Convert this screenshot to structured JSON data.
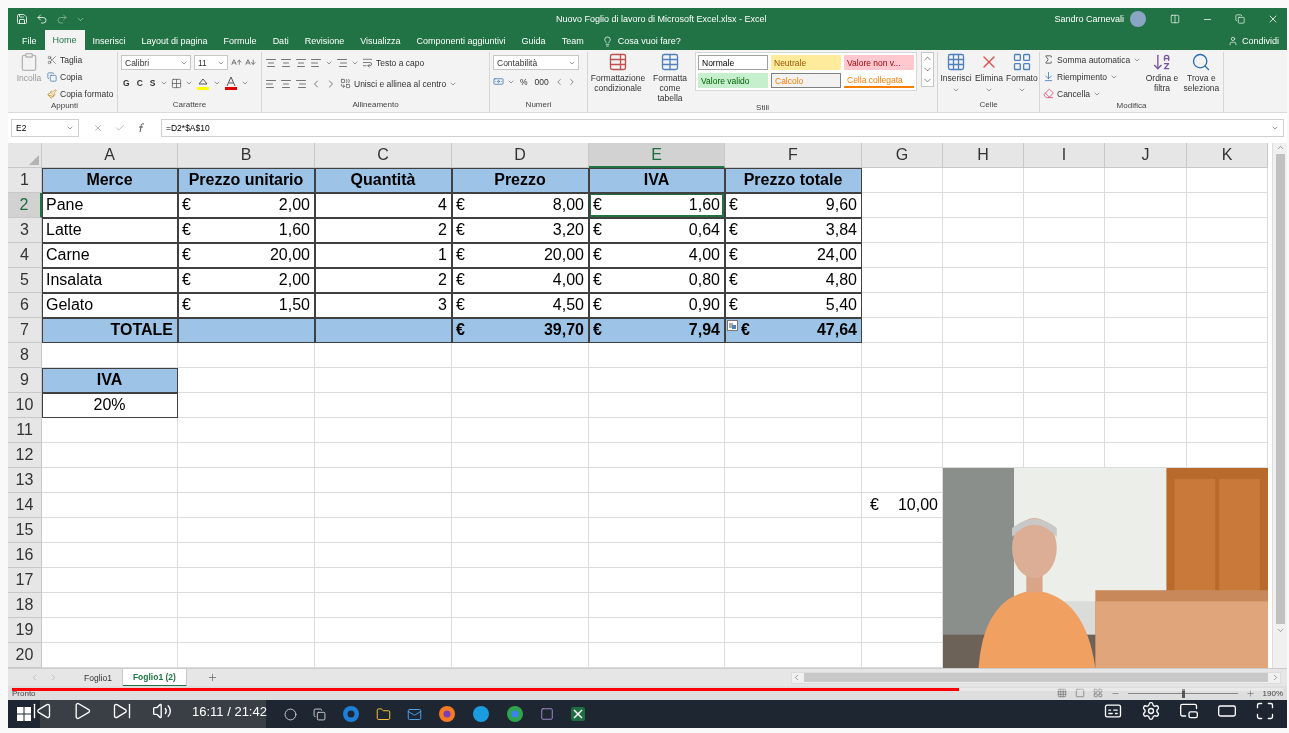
{
  "title_bar": {
    "title": "Nuovo Foglio di lavoro di Microsoft Excel.xlsx  -  Excel",
    "user": "Sandro Carnevali"
  },
  "menu_tabs": [
    {
      "label": "File",
      "selected": false
    },
    {
      "label": "Home",
      "selected": true
    },
    {
      "label": "Inserisci",
      "selected": false
    },
    {
      "label": "Layout di pagina",
      "selected": false
    },
    {
      "label": "Formule",
      "selected": false
    },
    {
      "label": "Dati",
      "selected": false
    },
    {
      "label": "Revisione",
      "selected": false
    },
    {
      "label": "Visualizza",
      "selected": false
    },
    {
      "label": "Componenti aggiuntivi",
      "selected": false
    },
    {
      "label": "Guida",
      "selected": false
    },
    {
      "label": "Team",
      "selected": false
    }
  ],
  "tell_me": {
    "placeholder": "Cosa vuoi fare?"
  },
  "share": "Condividi",
  "ribbon": [
    {
      "kind": "clipboard",
      "label": "Appunti",
      "items": [
        {
          "label": "Incolla",
          "disabled": true
        },
        {
          "label": "Taglia",
          "disabled": false
        },
        {
          "label": "Copia",
          "disabled": false
        },
        {
          "label": "Copia formato",
          "disabled": false
        }
      ]
    },
    {
      "kind": "font",
      "label": "Carattere",
      "font": "Calibri",
      "size": "11",
      "buttons": [
        "G",
        "C",
        "S"
      ]
    },
    {
      "kind": "alignment",
      "label": "Allineamento",
      "items": [
        "Testo a capo",
        "Unisci e allinea al centro"
      ]
    },
    {
      "kind": "number",
      "label": "Numeri",
      "format": "Contabilità",
      "buttons": [
        "%",
        "000"
      ]
    },
    {
      "kind": "styles",
      "label": "Stili",
      "items": [
        "Formattazione condizionale",
        "Formatta come tabella"
      ],
      "cell_styles": [
        {
          "label": "Normale",
          "kind": "normal"
        },
        {
          "label": "Neutrale",
          "kind": "neutral"
        },
        {
          "label": "Valore non v...",
          "kind": "bad"
        },
        {
          "label": "Valore valido",
          "kind": "good"
        },
        {
          "label": "Calcolo",
          "kind": "calc"
        },
        {
          "label": "Cella collegata",
          "kind": "linked"
        }
      ]
    },
    {
      "kind": "cells",
      "label": "Celle",
      "items": [
        "Inserisci",
        "Elimina",
        "Formato"
      ]
    },
    {
      "kind": "editing",
      "label": "Modifica",
      "items": [
        "Somma automatica",
        "Riempimento",
        "Cancella"
      ],
      "large_items": [
        "Ordina e filtra",
        "Trova e seleziona"
      ]
    }
  ],
  "formula_bar": {
    "name_box": "E2",
    "formula": "=D2*$A$10"
  },
  "columns": [
    {
      "label": "A",
      "selected": false
    },
    {
      "label": "B",
      "selected": false
    },
    {
      "label": "C",
      "selected": false
    },
    {
      "label": "D",
      "selected": false
    },
    {
      "label": "E",
      "selected": true
    },
    {
      "label": "F",
      "selected": false
    },
    {
      "label": "G",
      "selected": false
    },
    {
      "label": "H",
      "selected": false
    },
    {
      "label": "I",
      "selected": false
    },
    {
      "label": "J",
      "selected": false
    },
    {
      "label": "K",
      "selected": false
    }
  ],
  "rows": [
    {
      "label": "1",
      "selected": false,
      "cells": [
        {
          "kind": "header",
          "text": "Merce"
        },
        {
          "kind": "header",
          "text": "Prezzo unitario"
        },
        {
          "kind": "header",
          "text": "Quantità"
        },
        {
          "kind": "header",
          "text": "Prezzo"
        },
        {
          "kind": "header",
          "text": "IVA"
        },
        {
          "kind": "header",
          "text": "Prezzo totale"
        }
      ]
    },
    {
      "label": "2",
      "selected": true,
      "cells": [
        {
          "kind": "item",
          "text": "Pane"
        },
        {
          "kind": "price",
          "symbol": "€",
          "amount": "2,00"
        },
        {
          "kind": "quantity",
          "text": "4"
        },
        {
          "kind": "price",
          "symbol": "€",
          "amount": "8,00"
        },
        {
          "kind": "price",
          "symbol": "€",
          "amount": "1,60"
        },
        {
          "kind": "price",
          "symbol": "€",
          "amount": "9,60"
        }
      ]
    },
    {
      "label": "3",
      "selected": false,
      "cells": [
        {
          "kind": "item",
          "text": "Latte"
        },
        {
          "kind": "price",
          "symbol": "€",
          "amount": "1,60"
        },
        {
          "kind": "quantity",
          "text": "2"
        },
        {
          "kind": "price",
          "symbol": "€",
          "amount": "3,20"
        },
        {
          "kind": "price",
          "symbol": "€",
          "amount": "0,64"
        },
        {
          "kind": "price",
          "symbol": "€",
          "amount": "3,84"
        }
      ]
    },
    {
      "label": "4",
      "selected": false,
      "cells": [
        {
          "kind": "item",
          "text": "Carne"
        },
        {
          "kind": "price",
          "symbol": "€",
          "amount": "20,00"
        },
        {
          "kind": "quantity",
          "text": "1"
        },
        {
          "kind": "price",
          "symbol": "€",
          "amount": "20,00"
        },
        {
          "kind": "price",
          "symbol": "€",
          "amount": "4,00"
        },
        {
          "kind": "price",
          "symbol": "€",
          "amount": "24,00"
        }
      ]
    },
    {
      "label": "5",
      "selected": false,
      "cells": [
        {
          "kind": "item",
          "text": "Insalata"
        },
        {
          "kind": "price",
          "symbol": "€",
          "amount": "2,00"
        },
        {
          "kind": "quantity",
          "text": "2"
        },
        {
          "kind": "price",
          "symbol": "€",
          "amount": "4,00"
        },
        {
          "kind": "price",
          "symbol": "€",
          "amount": "0,80"
        },
        {
          "kind": "price",
          "symbol": "€",
          "amount": "4,80"
        }
      ]
    },
    {
      "label": "6",
      "selected": false,
      "cells": [
        {
          "kind": "item",
          "text": "Gelato"
        },
        {
          "kind": "price",
          "symbol": "€",
          "amount": "1,50"
        },
        {
          "kind": "quantity",
          "text": "3"
        },
        {
          "kind": "price",
          "symbol": "€",
          "amount": "4,50"
        },
        {
          "kind": "price",
          "symbol": "€",
          "amount": "0,90"
        },
        {
          "kind": "price",
          "symbol": "€",
          "amount": "5,40"
        }
      ]
    },
    {
      "label": "7",
      "selected": false,
      "cells": [
        {
          "kind": "total_label",
          "text": "TOTALE"
        },
        {
          "kind": "total_blank"
        },
        {
          "kind": "total_blank"
        },
        {
          "kind": "total_price",
          "symbol": "€",
          "amount": "39,70"
        },
        {
          "kind": "total_price",
          "symbol": "€",
          "amount": "7,94"
        },
        {
          "kind": "total_price",
          "symbol": "€",
          "amount": "47,64",
          "paste_options": true
        }
      ]
    },
    {
      "label": "8",
      "selected": false,
      "cells": []
    },
    {
      "label": "9",
      "selected": false,
      "cells": [
        {
          "kind": "header",
          "text": "IVA"
        }
      ]
    },
    {
      "label": "10",
      "selected": false,
      "cells": [
        {
          "kind": "rate",
          "text": "20%"
        }
      ]
    },
    {
      "label": "11",
      "selected": false,
      "cells": []
    },
    {
      "label": "12",
      "selected": false,
      "cells": []
    },
    {
      "label": "13",
      "selected": false,
      "cells": []
    },
    {
      "label": "14",
      "selected": false,
      "cells": [
        {
          "kind": "empty"
        },
        {
          "kind": "empty"
        },
        {
          "kind": "empty"
        },
        {
          "kind": "empty"
        },
        {
          "kind": "empty"
        },
        {
          "kind": "empty"
        },
        {
          "kind": "loose_price",
          "symbol": "€",
          "amount": "10,00"
        }
      ]
    },
    {
      "label": "15",
      "selected": false,
      "cells": []
    },
    {
      "label": "16",
      "selected": false,
      "cells": []
    },
    {
      "label": "17",
      "selected": false,
      "cells": []
    },
    {
      "label": "18",
      "selected": false,
      "cells": []
    },
    {
      "label": "19",
      "selected": false,
      "cells": []
    },
    {
      "label": "20",
      "selected": false,
      "cells": []
    }
  ],
  "sheet_tabs": [
    {
      "label": "Foglio1",
      "selected": false
    },
    {
      "label": "Foglio1 (2)",
      "selected": true
    }
  ],
  "status_bar": {
    "status": "Pronto",
    "zoom": {
      "text": "190%",
      "level": 0.5
    }
  },
  "player": {
    "time": "16:11 / 21:42",
    "progress": {
      "level": 0.745
    }
  }
}
